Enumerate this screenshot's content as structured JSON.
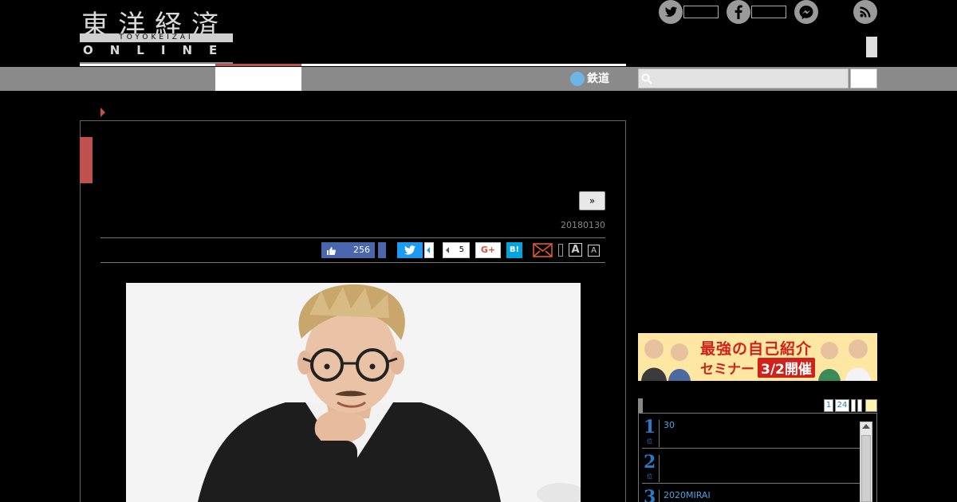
{
  "header": {
    "logo_kanji": "東洋経済",
    "logo_bar": "TOYOKEIZAI",
    "logo_online": "ONLINE"
  },
  "nav": {
    "rail_label": "鉄道"
  },
  "search": {
    "placeholder": ""
  },
  "article": {
    "next_label": "»",
    "date": "20180130",
    "share": {
      "like_count": "256",
      "pocket_count": "5",
      "gplus_label": "G+",
      "hatena_label": "B!",
      "font_large": "A",
      "font_small": "A"
    }
  },
  "sidebar": {
    "banner": {
      "headline": "最強の自己紹介",
      "sub": "セミナー",
      "date": "3/2開催"
    },
    "ranking_tabs": [
      "1",
      "24"
    ],
    "ranking_items": [
      {
        "rank": "1",
        "unit": "位",
        "text": "30"
      },
      {
        "rank": "2",
        "unit": "位",
        "text": ""
      },
      {
        "rank": "3",
        "unit": "位",
        "text": "2020MIRAI"
      }
    ]
  },
  "colors": {
    "accent": "#c0504d",
    "nav_gray": "#8a8a8a",
    "link_blue": "#2a7bc4"
  }
}
